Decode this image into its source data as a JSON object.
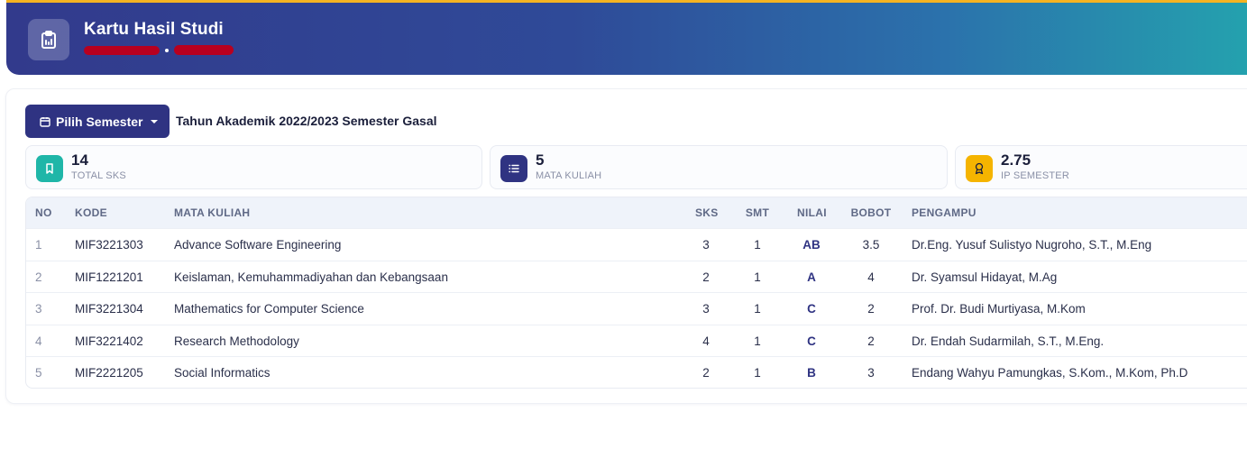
{
  "header": {
    "title": "Kartu Hasil Studi",
    "icon": "clipboard-icon",
    "gradient_from": "#323a8c",
    "gradient_to": "#24a3ae",
    "accent": "#f5b322"
  },
  "toolbar": {
    "semester_button_label": "Pilih Semester",
    "semester_label": "Tahun Akademik 2022/2023 Semester Gasal"
  },
  "stats": [
    {
      "value": "14",
      "label": "TOTAL SKS",
      "icon": "bookmark-icon",
      "color": "#1fb6a8"
    },
    {
      "value": "5",
      "label": "MATA KULIAH",
      "icon": "list-icon",
      "color": "#2f3382"
    },
    {
      "value": "2.75",
      "label": "IP SEMESTER",
      "icon": "award-icon",
      "color": "#f5b400"
    }
  ],
  "table": {
    "headers": {
      "no": "NO",
      "kode": "KODE",
      "mata_kuliah": "MATA KULIAH",
      "sks": "SKS",
      "smt": "SMT",
      "nilai": "NILAI",
      "bobot": "BOBOT",
      "pengampu": "PENGAMPU"
    },
    "rows": [
      {
        "no": "1",
        "kode": "MIF3221303",
        "mata_kuliah": "Advance Software Engineering",
        "sks": "3",
        "smt": "1",
        "nilai": "AB",
        "bobot": "3.5",
        "pengampu": "Dr.Eng. Yusuf Sulistyo Nugroho, S.T., M.Eng"
      },
      {
        "no": "2",
        "kode": "MIF1221201",
        "mata_kuliah": "Keislaman, Kemuhammadiyahan dan Kebangsaan",
        "sks": "2",
        "smt": "1",
        "nilai": "A",
        "bobot": "4",
        "pengampu": "Dr. Syamsul Hidayat, M.Ag"
      },
      {
        "no": "3",
        "kode": "MIF3221304",
        "mata_kuliah": "Mathematics for Computer Science",
        "sks": "3",
        "smt": "1",
        "nilai": "C",
        "bobot": "2",
        "pengampu": "Prof. Dr. Budi Murtiyasa, M.Kom"
      },
      {
        "no": "4",
        "kode": "MIF3221402",
        "mata_kuliah": "Research Methodology",
        "sks": "4",
        "smt": "1",
        "nilai": "C",
        "bobot": "2",
        "pengampu": "Dr. Endah Sudarmilah, S.T., M.Eng."
      },
      {
        "no": "5",
        "kode": "MIF2221205",
        "mata_kuliah": "Social Informatics",
        "sks": "2",
        "smt": "1",
        "nilai": "B",
        "bobot": "3",
        "pengampu": "Endang Wahyu Pamungkas, S.Kom., M.Kom, Ph.D"
      }
    ]
  }
}
